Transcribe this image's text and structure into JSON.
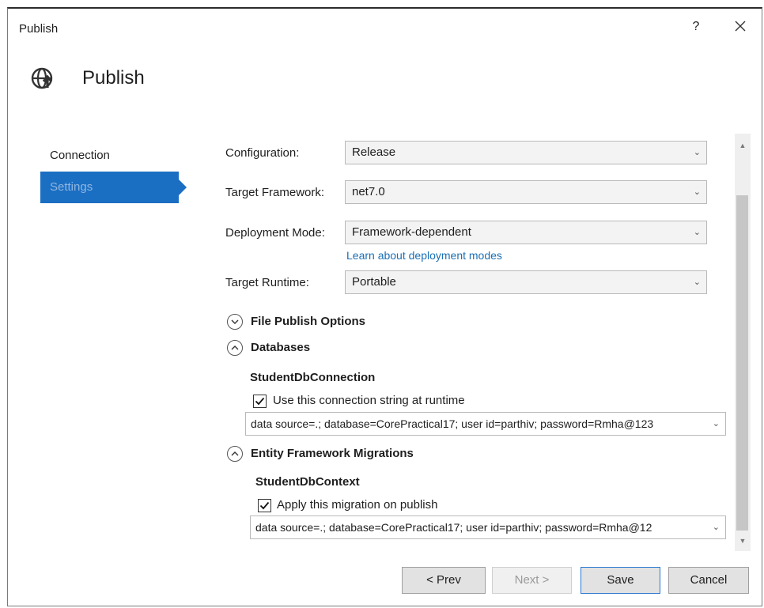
{
  "window": {
    "title": "Publish",
    "help_label": "?"
  },
  "header": {
    "title": "Publish"
  },
  "nav": {
    "items": [
      {
        "label": "Connection"
      },
      {
        "label": "Settings"
      }
    ]
  },
  "settings": {
    "configuration": {
      "label": "Configuration:",
      "value": "Release"
    },
    "target_framework": {
      "label": "Target Framework:",
      "value": "net7.0"
    },
    "deployment_mode": {
      "label": "Deployment Mode:",
      "value": "Framework-dependent",
      "link": "Learn about deployment modes"
    },
    "target_runtime": {
      "label": "Target Runtime:",
      "value": "Portable"
    }
  },
  "sections": {
    "file_publish": {
      "title": "File Publish Options",
      "expanded": false
    },
    "databases": {
      "title": "Databases",
      "expanded": true,
      "connection_name": "StudentDbConnection",
      "checkbox_label": "Use this connection string at runtime",
      "checked": true,
      "connection_string": "data source=.; database=CorePractical17; user id=parthiv; password=Rmha@123"
    },
    "ef_migrations": {
      "title": "Entity Framework Migrations",
      "expanded": true,
      "context_name": "StudentDbContext",
      "checkbox_label": "Apply this migration on publish",
      "checked": true,
      "connection_string": "data source=.; database=CorePractical17; user id=parthiv; password=Rmha@12"
    }
  },
  "footer": {
    "prev_label": "< Prev",
    "next_label": "Next >",
    "save_label": "Save",
    "cancel_label": "Cancel"
  },
  "colors": {
    "accent": "#1b6fc3",
    "link": "#1a6fb5"
  }
}
